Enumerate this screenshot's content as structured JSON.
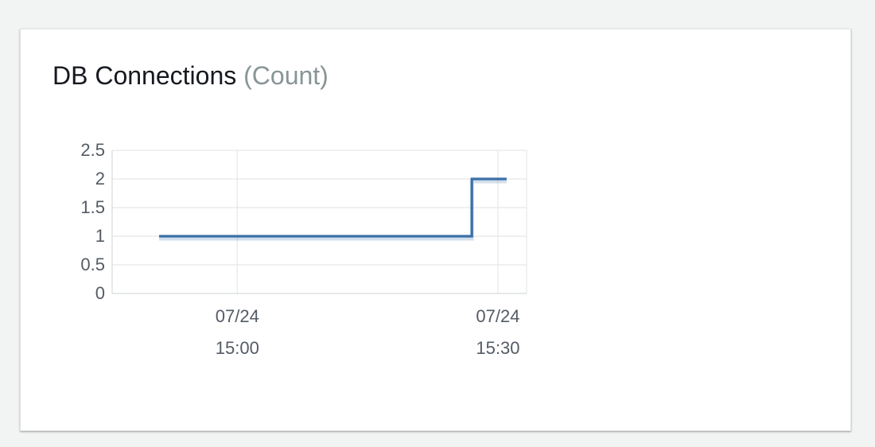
{
  "widget": {
    "title": "DB Connections",
    "unit": "(Count)"
  },
  "chart_data": {
    "type": "line",
    "title": "DB Connections (Count)",
    "xlabel": "",
    "ylabel": "",
    "ylim": [
      0,
      2.5
    ],
    "y_ticks": [
      "0",
      "0.5",
      "1",
      "1.5",
      "2",
      "2.5"
    ],
    "x_ticks": [
      {
        "date": "07/24",
        "time": "15:00"
      },
      {
        "date": "07/24",
        "time": "15:30"
      }
    ],
    "grid": true,
    "series": [
      {
        "values": [
          {
            "x": "14:51",
            "y": 1
          },
          {
            "x": "15:27",
            "y": 1
          },
          {
            "x": "15:27",
            "y": 2
          },
          {
            "x": "15:31",
            "y": 2
          }
        ]
      }
    ],
    "colors": {
      "line": "#3b6fa8",
      "grid": "#e6e8e8",
      "axis": "#d5dbdb"
    }
  }
}
